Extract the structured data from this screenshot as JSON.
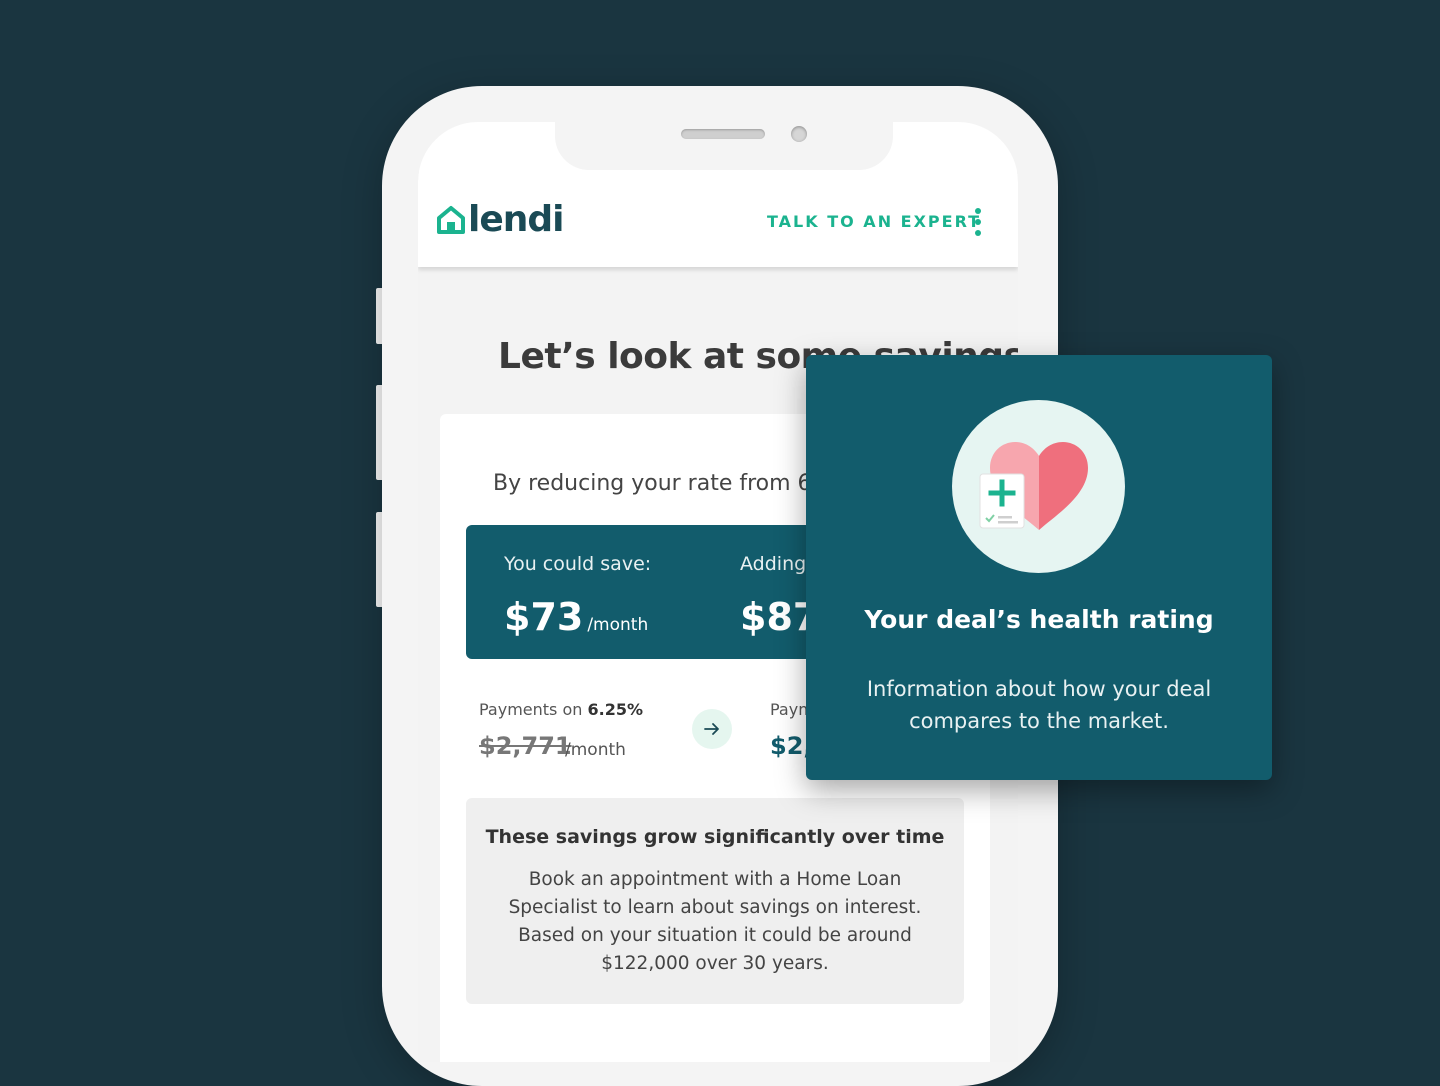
{
  "colors": {
    "background": "#1a3540",
    "accent": "#1bb38f",
    "primary": "#125c6c"
  },
  "header": {
    "logo_text": "lendi",
    "logo_icon": "house-icon",
    "talk_link": "TALK TO AN EXPERT",
    "menu_icon": "kebab-menu-icon"
  },
  "main": {
    "title": "Let’s look at some savings",
    "intro": "By reducing your rate from 6.2",
    "savings": {
      "save_label": "You could save:",
      "save_amount": "$73",
      "save_unit": "/month",
      "adding_label": "Adding",
      "adding_amount": "$87"
    },
    "payments": {
      "current_label_prefix": "Payments on ",
      "current_rate": "6.25%",
      "current_amount": "$2,771",
      "current_unit": "/month",
      "arrow_icon": "arrow-right-icon",
      "new_label": "Paym",
      "new_amount": "$2,"
    },
    "info": {
      "title": "These savings grow significantly over time",
      "body": "Book an appointment with a Home Loan Specialist to learn about savings on interest. Based on your situation it could be around $122,000 over 30 years."
    }
  },
  "popup": {
    "icon": "heart-health-icon",
    "title": "Your deal’s health rating",
    "body": "Information about how your deal compares to the market."
  }
}
